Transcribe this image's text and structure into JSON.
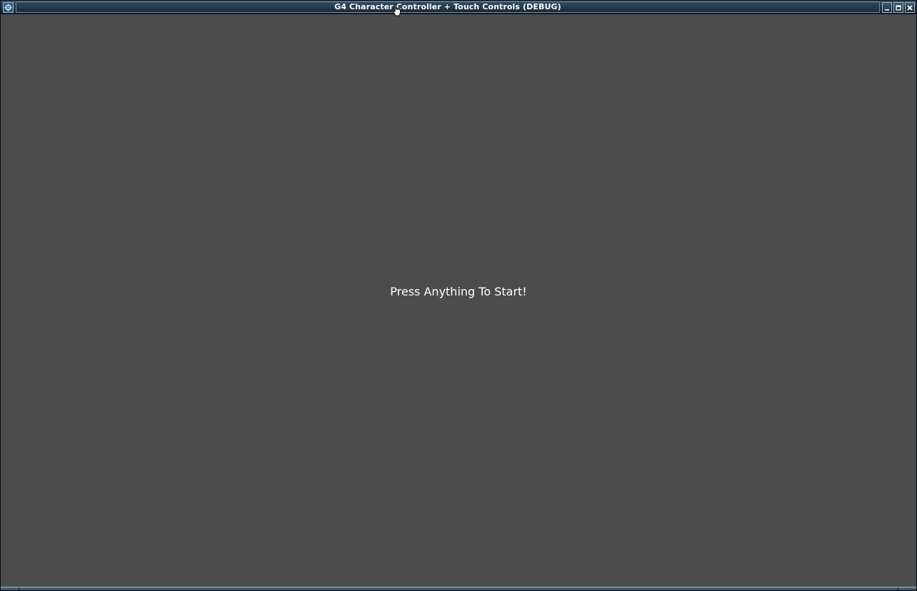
{
  "window": {
    "title": "G4 Character Controller + Touch Controls (DEBUG)",
    "icons": {
      "app": "gear-icon",
      "minimize": "minimize-icon",
      "maximize": "maximize-icon",
      "close": "close-icon"
    }
  },
  "game": {
    "prompt": "Press Anything To Start!",
    "background_color": "#4c4c4c",
    "text_color": "#ffffff"
  }
}
